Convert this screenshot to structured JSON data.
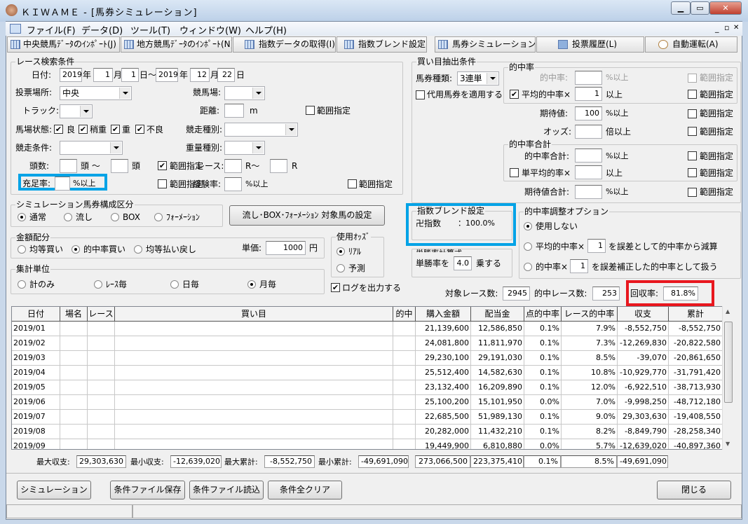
{
  "window": {
    "title": "ＫＩＷＡＭＥ - [馬券シミュレーション]",
    "min": "▁",
    "max": "▭",
    "close": "✕"
  },
  "menu": [
    "ファイル(F)",
    "データ(D)",
    "ツール(T)",
    "ウィンドウ(W)",
    "ヘルプ(H)"
  ],
  "mdi": {
    "min": "_",
    "restore": "▫",
    "close": "✕"
  },
  "toolbar": [
    "中央競馬ﾃﾞｰﾀのｲﾝﾎﾟｰﾄ(J)",
    "地方競馬ﾃﾞｰﾀのｲﾝﾎﾟｰﾄ(N)",
    "指数データの取得(I)",
    "指数ブレンド設定(M)",
    "馬券シミュレーション(B)",
    "投票履歴(L)",
    "自動運転(A)"
  ],
  "race": {
    "title": "レース検索条件",
    "date_label": "日付:",
    "y1": "2019",
    "m1": "1",
    "d1": "1",
    "y2": "2019",
    "m2": "12",
    "d2": "22",
    "nen": "年",
    "tsuki": "月",
    "hi": "日",
    "hi_tilde": "日～",
    "place_label": "投票場所:",
    "place": "中央",
    "course_label": "競馬場:",
    "course": "",
    "track_label": "トラック:",
    "track": "",
    "dist_label": "距離:",
    "dist": "",
    "dist_unit": "m",
    "range": "範囲指定",
    "cond_label": "馬場状態:",
    "conds": [
      "良",
      "稍重",
      "重",
      "不良"
    ],
    "kind_label": "競走種別:",
    "kind": "",
    "race_cond_label": "競走条件:",
    "race_cond": "",
    "weight_label": "重量種別:",
    "weight": "",
    "heads_label": "頭数:",
    "head_unit_tilde": "頭 ～",
    "head_unit": "頭",
    "race_label": "レース:",
    "r_tilde": "R～",
    "r": "R",
    "fill_label": "充足率:",
    "pct_over": "%以上",
    "exp_label": "経験率:"
  },
  "buy": {
    "title": "買い目抽出条件",
    "type_label": "馬券種類:",
    "type": "3連単",
    "subst": "代用馬券を適用する",
    "hit": {
      "title": "的中率",
      "hit_label": "的中率:",
      "pct_over": "%以上",
      "avg_label": "平均的中率×",
      "avg": "1",
      "over": "以上"
    },
    "ev_label": "期待値:",
    "ev": "100",
    "odds_label": "オッズ:",
    "odds_unit": "倍以上",
    "sum": {
      "title": "的中率合計",
      "total_label": "的中率合計:",
      "single_label": "単平均的率×",
      "ev_total_label": "期待値合計:"
    },
    "range": "範囲指定"
  },
  "sim": {
    "title": "シミュレーション馬券構成区分",
    "options": [
      "通常",
      "流し",
      "BOX",
      "ﾌｫｰﾒｰｼｮﾝ"
    ],
    "selected": 0,
    "button": "流し･BOX･ﾌｫｰﾒｰｼｮﾝ 対象馬の設定"
  },
  "money": {
    "title": "金額配分",
    "options": [
      "均等買い",
      "的中率買い",
      "均等払い戻し"
    ],
    "selected": 1,
    "unit_label": "単価:",
    "unit": "1000",
    "yen": "円"
  },
  "odds": {
    "title": "使用ｵｯｽﾞ",
    "options": [
      "ﾘｱﾙ",
      "予測"
    ],
    "selected": 0
  },
  "agg": {
    "title": "集計単位",
    "options": [
      "計のみ",
      "ﾚｰｽ毎",
      "日毎",
      "月毎"
    ],
    "selected": 3
  },
  "log": "ログを出力する",
  "blend": {
    "title": "指数ブレンド設定",
    "name": "卍指数",
    "value": "：100.0%"
  },
  "win": {
    "title": "単勝率計算式",
    "pre": "単勝率を",
    "value": "4.0",
    "post": "乗する"
  },
  "adj": {
    "title": "的中率調整オプション",
    "opt0": "使用しない",
    "opt1_pre": "平均的中率×",
    "opt1_val": "1",
    "opt1_post": "を誤差として的中率から減算",
    "opt2_pre": "的中率×",
    "opt2_val": "1",
    "opt2_post": "を誤差補正した的中率として扱う"
  },
  "stats": {
    "target_label": "対象レース数:",
    "target": "2945",
    "hit_label": "的中レース数:",
    "hit": "253",
    "recovery_label": "回収率:",
    "recovery": "81.8%"
  },
  "table": {
    "headers": [
      "日付",
      "場名",
      "レース",
      "買い目",
      "的中",
      "購入金額",
      "配当金",
      "点的中率",
      "レース的中率",
      "収支",
      "累計"
    ],
    "rows": [
      [
        "2019/01",
        "",
        "",
        "",
        "",
        "21,139,600",
        "12,586,850",
        "0.1%",
        "7.9%",
        "-8,552,750",
        "-8,552,750"
      ],
      [
        "2019/02",
        "",
        "",
        "",
        "",
        "24,081,800",
        "11,811,970",
        "0.1%",
        "7.3%",
        "-12,269,830",
        "-20,822,580"
      ],
      [
        "2019/03",
        "",
        "",
        "",
        "",
        "29,230,100",
        "29,191,030",
        "0.1%",
        "8.5%",
        "-39,070",
        "-20,861,650"
      ],
      [
        "2019/04",
        "",
        "",
        "",
        "",
        "25,512,400",
        "14,582,630",
        "0.1%",
        "10.8%",
        "-10,929,770",
        "-31,791,420"
      ],
      [
        "2019/05",
        "",
        "",
        "",
        "",
        "23,132,400",
        "16,209,890",
        "0.1%",
        "12.0%",
        "-6,922,510",
        "-38,713,930"
      ],
      [
        "2019/06",
        "",
        "",
        "",
        "",
        "25,100,200",
        "15,101,950",
        "0.0%",
        "7.0%",
        "-9,998,250",
        "-48,712,180"
      ],
      [
        "2019/07",
        "",
        "",
        "",
        "",
        "22,685,500",
        "51,989,130",
        "0.1%",
        "9.0%",
        "29,303,630",
        "-19,408,550"
      ],
      [
        "2019/08",
        "",
        "",
        "",
        "",
        "20,282,000",
        "11,432,210",
        "0.1%",
        "8.2%",
        "-8,849,790",
        "-28,258,340"
      ],
      [
        "2019/09",
        "",
        "",
        "",
        "",
        "19,449,900",
        "6,810,880",
        "0.0%",
        "5.7%",
        "-12,639,020",
        "-40,897,360"
      ]
    ]
  },
  "summary": {
    "max_label": "最大収支:",
    "max": "29,303,630",
    "min_label": "最小収支:",
    "min": "-12,639,020",
    "maxc_label": "最大累計:",
    "maxc": "-8,552,750",
    "minc_label": "最小累計:",
    "minc": "-49,691,090",
    "buy": "273,066,500",
    "pay": "223,375,410",
    "point": "0.1%",
    "race": "8.5%",
    "balance": "-49,691,090"
  },
  "buttons": {
    "simulate": "シミュレーション",
    "save": "条件ファイル保存",
    "load": "条件ファイル読込",
    "clear": "条件全クリア",
    "close": "閉じる"
  }
}
